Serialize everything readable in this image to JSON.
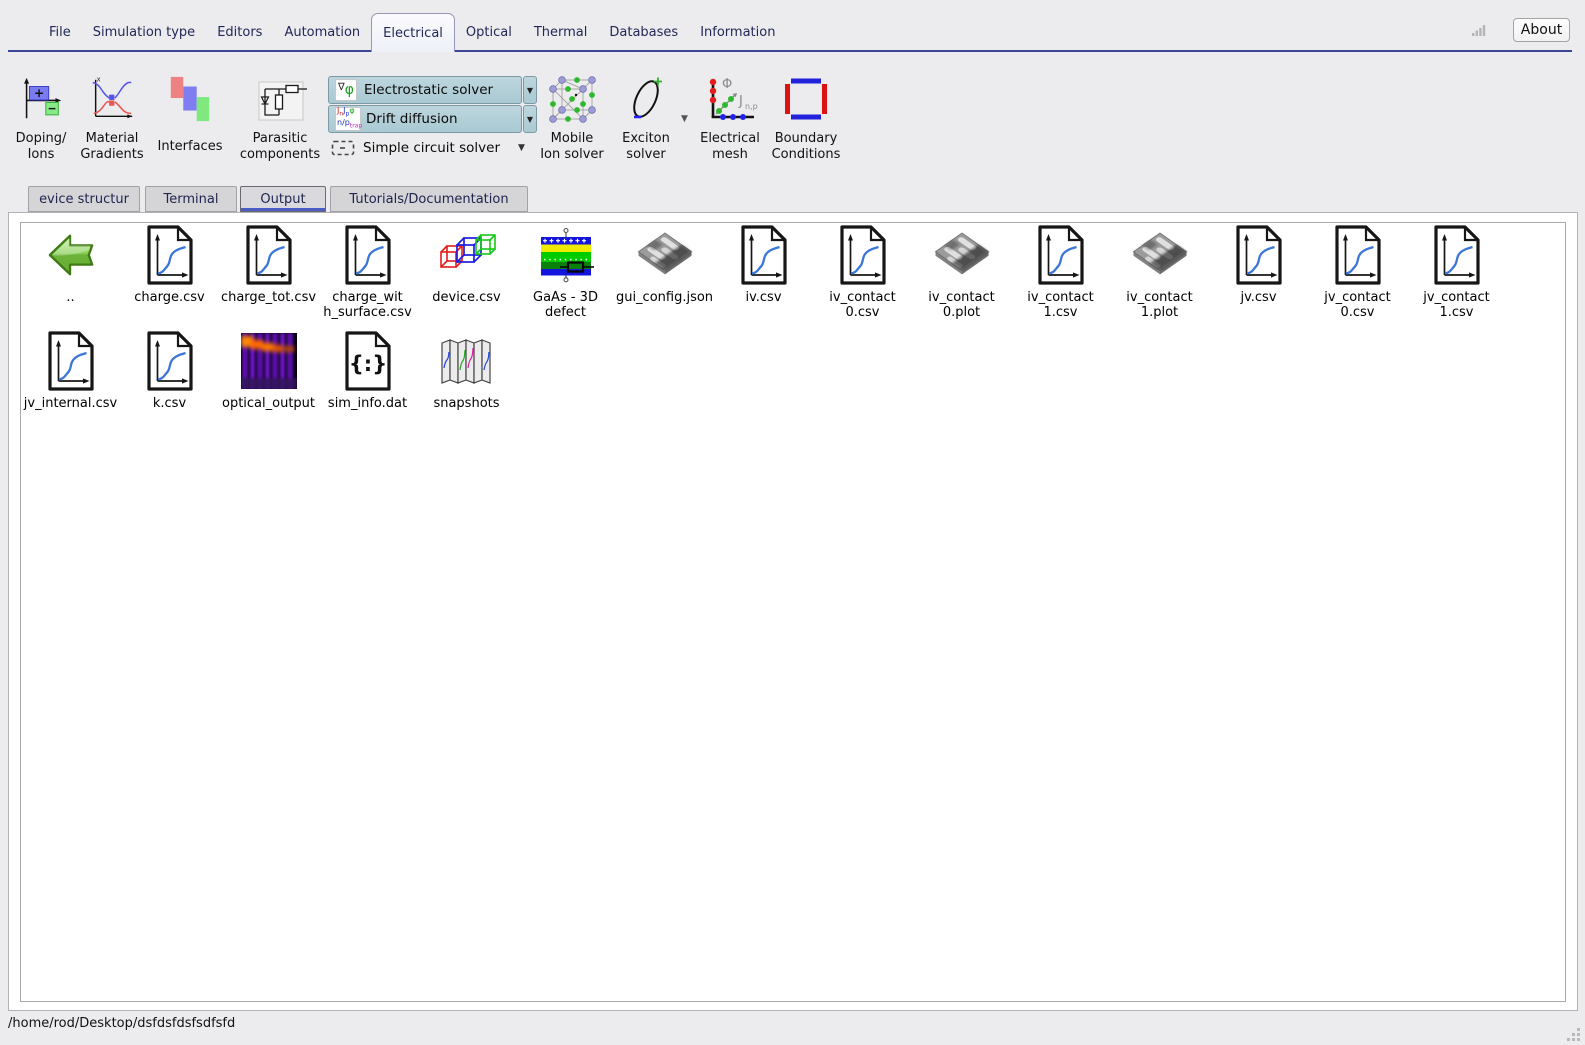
{
  "menubar": {
    "tabs": [
      {
        "label": "File"
      },
      {
        "label": "Simulation type"
      },
      {
        "label": "Editors"
      },
      {
        "label": "Automation"
      },
      {
        "label": "Electrical",
        "selected": true
      },
      {
        "label": "Optical"
      },
      {
        "label": "Thermal"
      },
      {
        "label": "Databases"
      },
      {
        "label": "Information"
      }
    ],
    "about_label": "About"
  },
  "ribbon": {
    "buttons": [
      {
        "label": "Doping/\nIons"
      },
      {
        "label": "Material\nGradients"
      },
      {
        "label": "Interfaces"
      },
      {
        "label": "Parasitic\ncomponents"
      },
      {
        "label": "Mobile\nIon solver"
      },
      {
        "label": "Exciton\nsolver"
      },
      {
        "label": "Electrical\nmesh"
      },
      {
        "label": "Boundary\nConditions"
      }
    ],
    "solver_dropdowns": [
      {
        "label": "Electrostatic solver"
      },
      {
        "label": "Drift diffusion"
      }
    ],
    "circuit_option": "Simple circuit solver",
    "electrostatic_icon": {
      "nabla": "∇",
      "phi": "φ"
    },
    "drift_icon": {
      "jn": "J",
      "jn_sub": "n",
      "jp": "J",
      "jp_sub": "p",
      "phi": "φ",
      "np": "n/p",
      "trap_sub": "trap"
    }
  },
  "tabbar": {
    "tabs": [
      {
        "label": "evice structur"
      },
      {
        "label": "Terminal"
      },
      {
        "label": "Output",
        "selected": true
      },
      {
        "label": "Tutorials/Documentation"
      }
    ]
  },
  "files": {
    "items": [
      {
        "name": "..",
        "icon": "back"
      },
      {
        "name": "charge.csv",
        "icon": "graph"
      },
      {
        "name": "charge_tot.csv",
        "icon": "graph"
      },
      {
        "name": "charge_wit\nh_surface.csv",
        "icon": "graph"
      },
      {
        "name": "device.csv",
        "icon": "cubes"
      },
      {
        "name": "GaAs - 3D\ndefect",
        "icon": "stack"
      },
      {
        "name": "gui_config.json",
        "icon": "chip"
      },
      {
        "name": "iv.csv",
        "icon": "graph"
      },
      {
        "name": "iv_contact\n0.csv",
        "icon": "graph"
      },
      {
        "name": "iv_contact\n0.plot",
        "icon": "chip"
      },
      {
        "name": "iv_contact\n1.csv",
        "icon": "graph"
      },
      {
        "name": "iv_contact\n1.plot",
        "icon": "chip"
      },
      {
        "name": "jv.csv",
        "icon": "graph"
      },
      {
        "name": "jv_contact\n0.csv",
        "icon": "graph"
      },
      {
        "name": "jv_contact\n1.csv",
        "icon": "graph"
      },
      {
        "name": "jv_internal.csv",
        "icon": "graph"
      },
      {
        "name": "k.csv",
        "icon": "graph"
      },
      {
        "name": "optical_output",
        "icon": "heatmap"
      },
      {
        "name": "sim_info.dat",
        "icon": "jsondoc"
      },
      {
        "name": "snapshots",
        "icon": "snapshots"
      }
    ]
  },
  "statusbar": {
    "path": "/home/rod/Desktop/dsfdsfdsfsdfsfd"
  },
  "colors": {
    "accent_blue": "#3b4796",
    "tab_underline": "#4c5cc5",
    "solver_button": "#b0ced8"
  }
}
